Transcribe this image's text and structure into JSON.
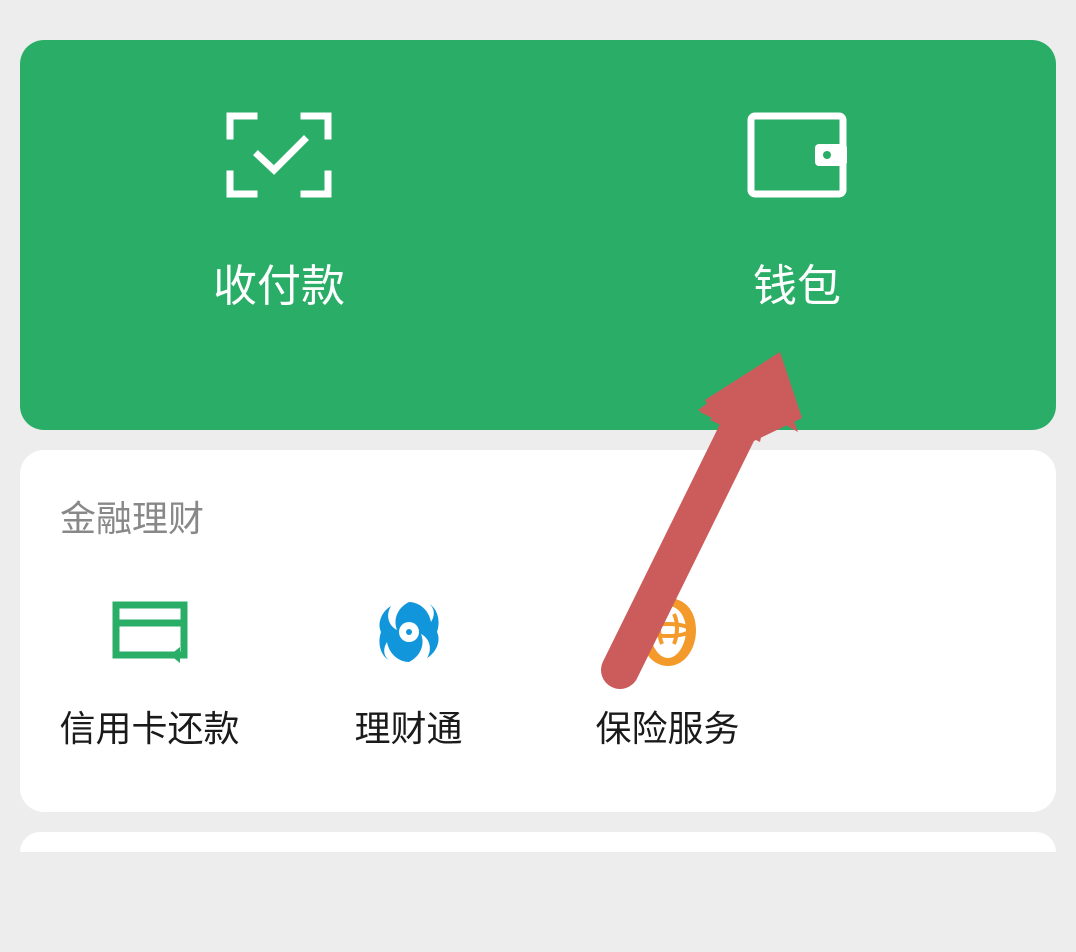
{
  "topCard": {
    "payReceive": {
      "label": "收付款"
    },
    "wallet": {
      "label": "钱包"
    }
  },
  "finance": {
    "title": "金融理财",
    "items": [
      {
        "label": "信用卡还款"
      },
      {
        "label": "理财通"
      },
      {
        "label": "保险服务"
      }
    ]
  },
  "colors": {
    "green": "#2aae67",
    "arrow": "#cc5b5b",
    "blue": "#1296db",
    "orange": "#f39a2b"
  }
}
